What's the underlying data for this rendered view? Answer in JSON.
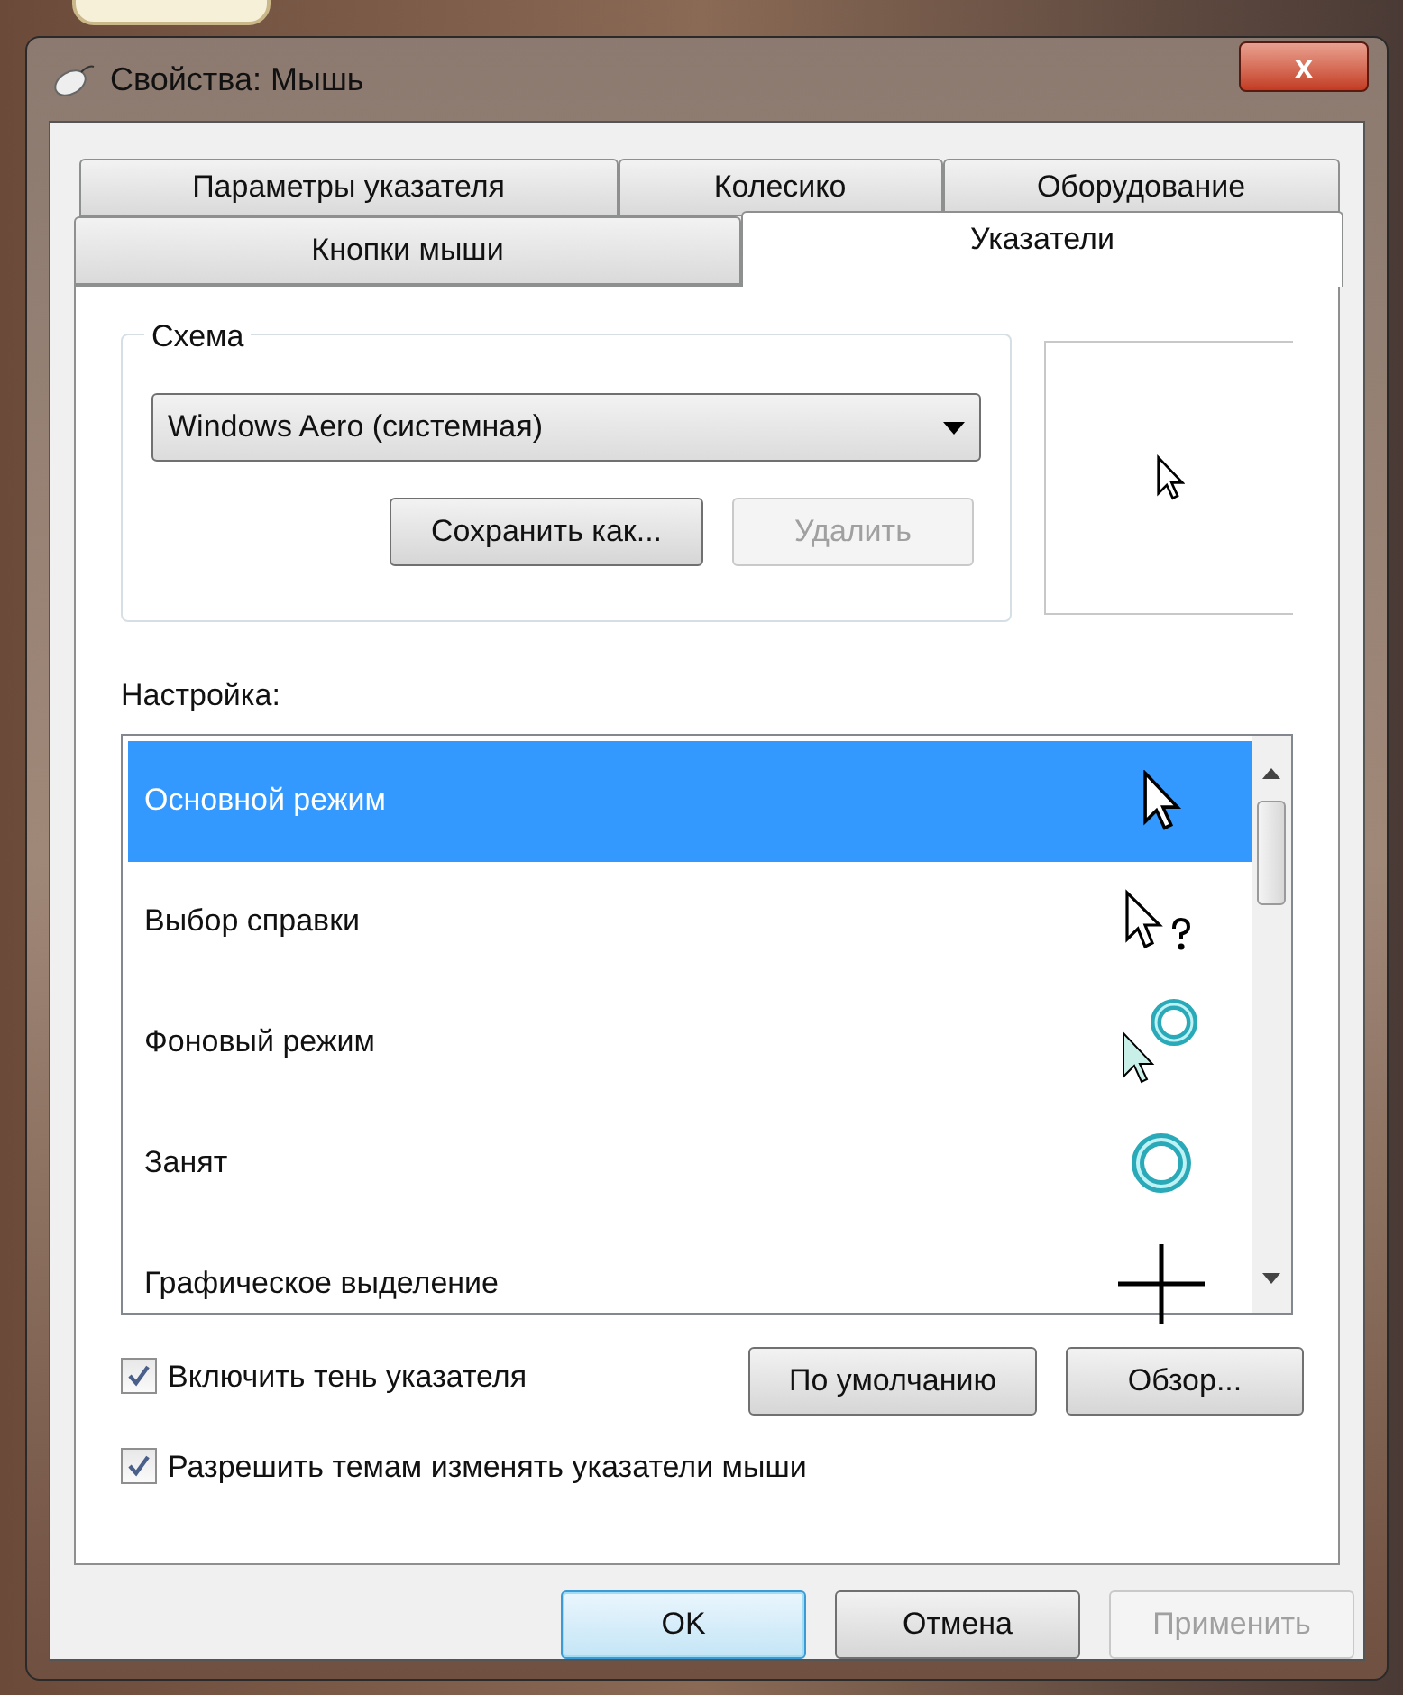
{
  "window": {
    "title": "Свойства: Мышь",
    "close": "x"
  },
  "tabs_top": [
    {
      "label": "Параметры указателя",
      "selected": false
    },
    {
      "label": "Колесико",
      "selected": false
    },
    {
      "label": "Оборудование",
      "selected": false
    }
  ],
  "tabs_bottom": [
    {
      "label": "Кнопки мыши",
      "selected": false
    },
    {
      "label": "Указатели",
      "selected": true
    }
  ],
  "scheme": {
    "title": "Схема",
    "value": "Windows Aero (системная)",
    "buttons": [
      {
        "label": "Сохранить как...",
        "disabled": false
      },
      {
        "label": "Удалить",
        "disabled": true
      }
    ]
  },
  "customize": {
    "label": "Настройка:",
    "items": [
      {
        "label": "Основной режим",
        "kind": "arrow",
        "selected": true
      },
      {
        "label": "Выбор справки",
        "kind": "help",
        "selected": false
      },
      {
        "label": "Фоновый режим",
        "kind": "working",
        "selected": false
      },
      {
        "label": "Занят",
        "kind": "busy",
        "selected": false
      },
      {
        "label": "Графическое выделение",
        "kind": "cross",
        "selected": false
      }
    ]
  },
  "options": [
    {
      "label": "Включить тень указателя",
      "checked": true
    },
    {
      "label": "Разрешить темам изменять указатели мыши",
      "checked": true
    }
  ],
  "list_buttons": [
    "По умолчанию",
    "Обзор..."
  ],
  "footer_buttons": [
    {
      "label": "OK",
      "kind": "default",
      "disabled": false
    },
    {
      "label": "Отмена",
      "kind": "normal",
      "disabled": false
    },
    {
      "label": "Применить",
      "kind": "normal",
      "disabled": true
    }
  ]
}
